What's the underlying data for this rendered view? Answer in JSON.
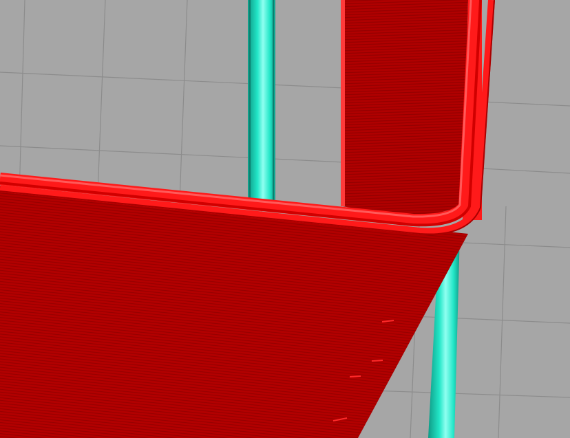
{
  "viewport": {
    "view_kind": "3d-preview",
    "subject": "sliced-toolpath-preview"
  },
  "colors": {
    "background": "#a6a6a6",
    "grid_line": "#8c8c8c",
    "travel_move": "#22e6c7",
    "travel_move_shadow": "#0f9a86",
    "travel_move_highlight": "#8ffff0",
    "perimeter_top": "#ff1a1a",
    "perimeter_highlight": "#ff5a5a",
    "wall_face": "#b30000",
    "wall_face_dark": "#8e0000",
    "layer_line": "#990000"
  },
  "icons": {
    "toolpath": "toolpath-icon"
  }
}
